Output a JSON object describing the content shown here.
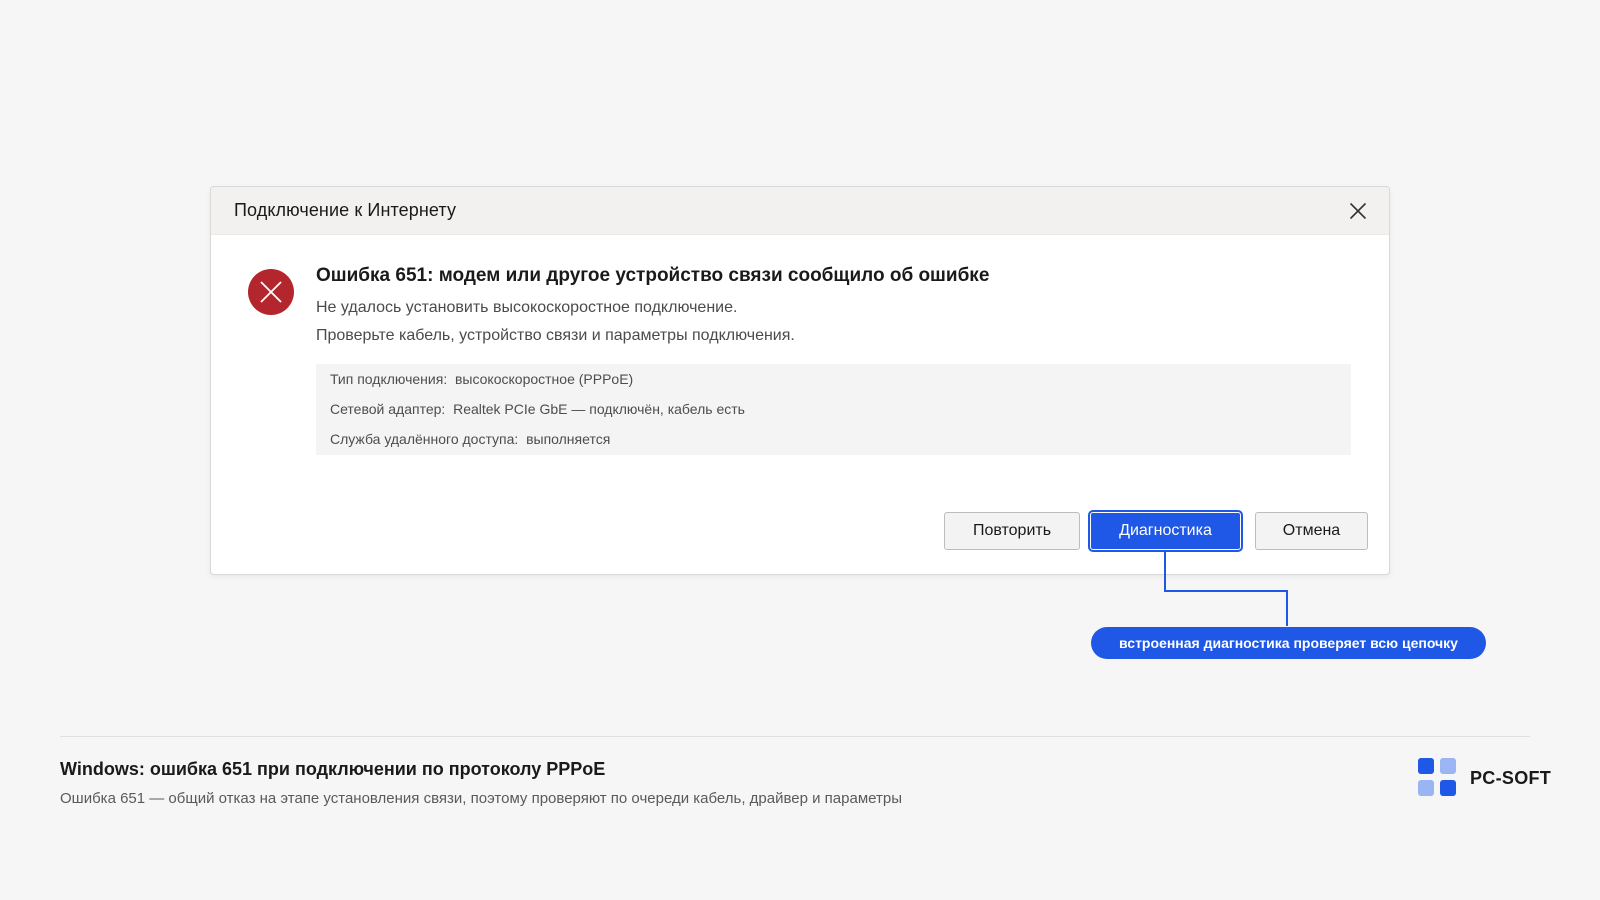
{
  "dialog": {
    "title": "Подключение к Интернету",
    "error_heading": "Ошибка 651: модем или другое устройство связи сообщило об ошибке",
    "message_line1": "Не удалось установить высокоскоростное подключение.",
    "message_line2": "Проверьте кабель, устройство связи и параметры подключения.",
    "details": [
      {
        "label": "Тип подключения:",
        "value": "высокоскоростное (PPPoE)"
      },
      {
        "label": "Сетевой адаптер:",
        "value": "Realtek PCIe GbE — подключён, кабель есть"
      },
      {
        "label": "Служба удалённого доступа:",
        "value": "выполняется"
      }
    ],
    "buttons": {
      "retry": "Повторить",
      "diagnostics": "Диагностика",
      "cancel": "Отмена"
    },
    "icons": {
      "close": "close-icon",
      "error": "error-icon"
    }
  },
  "callout": {
    "text": "встроенная диагностика проверяет всю цепочку"
  },
  "footer": {
    "title": "Windows: ошибка 651 при подключении по протоколу PPPoE",
    "subtitle": "Ошибка 651 — общий отказ на этапе установления связи, поэтому проверяют по очереди кабель, драйвер и параметры",
    "logo_text": "PC-SOFT"
  },
  "colors": {
    "accent": "#1f57e6",
    "error": "#b3262d",
    "background": "#f6f6f6",
    "logo_light": "#9bb4f3"
  }
}
